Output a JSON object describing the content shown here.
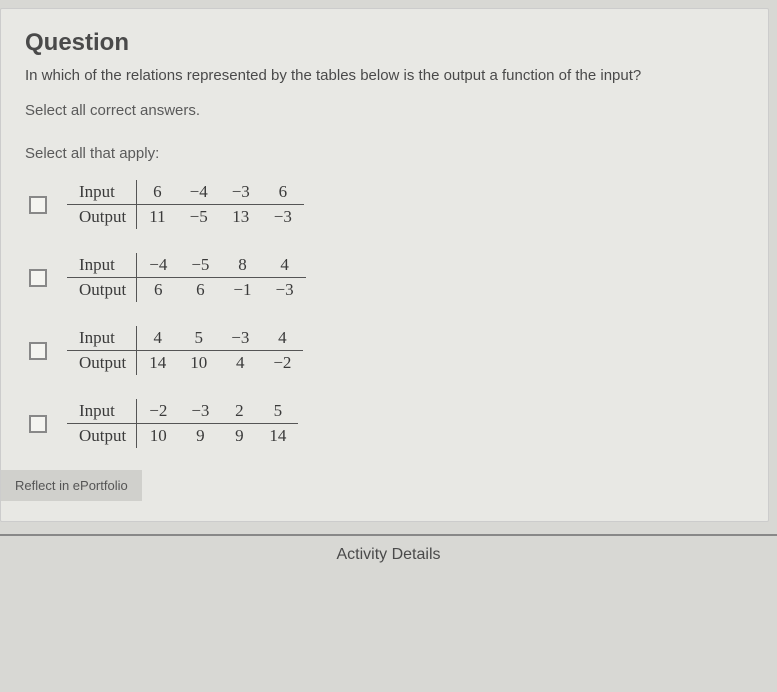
{
  "question": {
    "title": "Question",
    "prompt": "In which of the relations represented by the tables below is the output a function of the input?",
    "instruction": "Select all correct answers.",
    "select_apply": "Select all that apply:"
  },
  "labels": {
    "input": "Input",
    "output": "Output"
  },
  "options": [
    {
      "input": [
        6,
        -4,
        -3,
        6
      ],
      "output": [
        11,
        -5,
        13,
        -3
      ]
    },
    {
      "input": [
        -4,
        -5,
        8,
        4
      ],
      "output": [
        6,
        6,
        -1,
        -3
      ]
    },
    {
      "input": [
        4,
        5,
        -3,
        4
      ],
      "output": [
        14,
        10,
        4,
        -2
      ]
    },
    {
      "input": [
        -2,
        -3,
        2,
        5
      ],
      "output": [
        10,
        9,
        9,
        14
      ]
    }
  ],
  "footer": {
    "reflect": "Reflect in ePortfolio",
    "activity": "Activity Details"
  },
  "chart_data": [
    {
      "type": "table",
      "title": "Option 1",
      "columns": [
        "Input",
        "Output"
      ],
      "rows": [
        [
          6,
          11
        ],
        [
          -4,
          -5
        ],
        [
          -3,
          13
        ],
        [
          6,
          -3
        ]
      ]
    },
    {
      "type": "table",
      "title": "Option 2",
      "columns": [
        "Input",
        "Output"
      ],
      "rows": [
        [
          -4,
          6
        ],
        [
          -5,
          6
        ],
        [
          8,
          -1
        ],
        [
          4,
          -3
        ]
      ]
    },
    {
      "type": "table",
      "title": "Option 3",
      "columns": [
        "Input",
        "Output"
      ],
      "rows": [
        [
          4,
          14
        ],
        [
          5,
          10
        ],
        [
          -3,
          4
        ],
        [
          4,
          -2
        ]
      ]
    },
    {
      "type": "table",
      "title": "Option 4",
      "columns": [
        "Input",
        "Output"
      ],
      "rows": [
        [
          -2,
          10
        ],
        [
          -3,
          9
        ],
        [
          2,
          9
        ],
        [
          5,
          14
        ]
      ]
    }
  ]
}
